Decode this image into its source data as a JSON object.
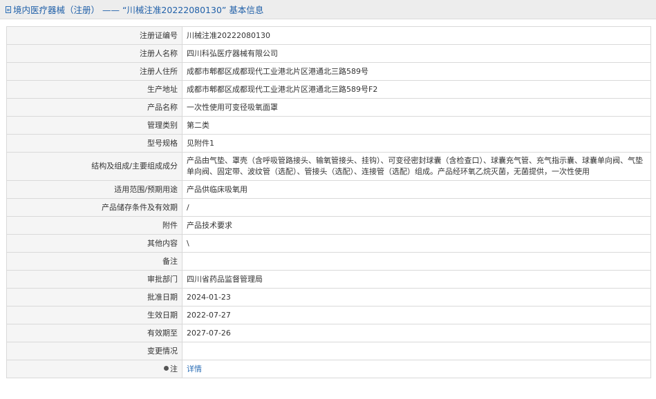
{
  "header": {
    "title": "境内医疗器械（注册） —— “川械注准20222080130” 基本信息",
    "icon": "document-icon"
  },
  "rows": [
    {
      "label": "注册证编号",
      "value": "川械注准20222080130"
    },
    {
      "label": "注册人名称",
      "value": "四川科弘医疗器械有限公司"
    },
    {
      "label": "注册人住所",
      "value": "成都市郫都区成都现代工业港北片区港通北三路589号"
    },
    {
      "label": "生产地址",
      "value": "成都市郫都区成都现代工业港北片区港通北三路589号F2"
    },
    {
      "label": "产品名称",
      "value": "一次性使用可变径吸氧面罩"
    },
    {
      "label": "管理类别",
      "value": "第二类"
    },
    {
      "label": "型号规格",
      "value": "见附件1"
    },
    {
      "label": "结构及组成/主要组成成分",
      "value": "产品由气垫、罩壳（含呼吸管路接头、输氧管接头、挂钩）、可变径密封球囊（含检查口）、球囊充气管、充气指示囊、球囊单向阀、气垫单向阀、固定带、波纹管（选配）、管接头（选配）、连接管（选配）组成。产品经环氧乙烷灭菌，无菌提供，一次性使用"
    },
    {
      "label": "适用范围/预期用途",
      "value": "产品供临床吸氧用"
    },
    {
      "label": "产品储存条件及有效期",
      "value": "/"
    },
    {
      "label": "附件",
      "value": "产品技术要求"
    },
    {
      "label": "其他内容",
      "value": "\\"
    },
    {
      "label": "备注",
      "value": ""
    },
    {
      "label": "审批部门",
      "value": "四川省药品监督管理局"
    },
    {
      "label": "批准日期",
      "value": "2024-01-23"
    },
    {
      "label": "生效日期",
      "value": "2022-07-27"
    },
    {
      "label": "有效期至",
      "value": "2027-07-26"
    },
    {
      "label": "变更情况",
      "value": ""
    }
  ],
  "note": {
    "label": "注",
    "link_text": "详情",
    "icon": "pin-icon"
  }
}
